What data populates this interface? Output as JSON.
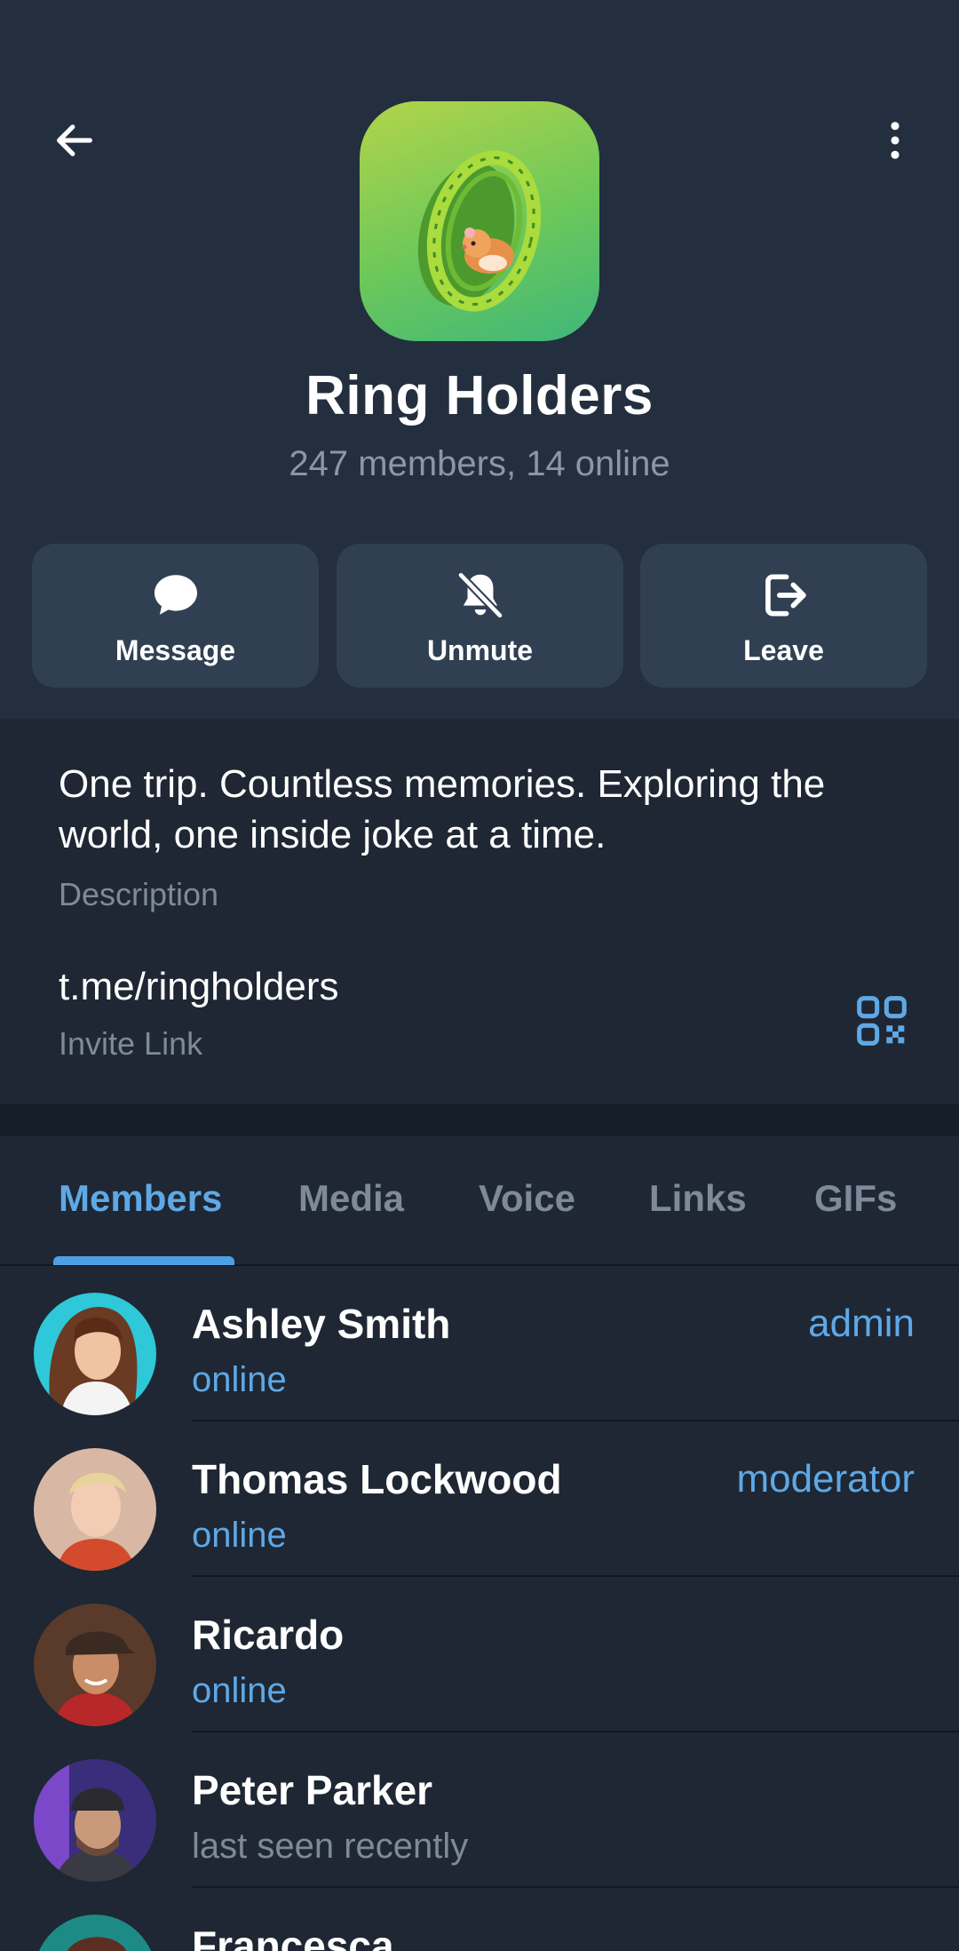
{
  "header": {
    "back_icon": "arrow-left-icon",
    "more_icon": "more-vertical-icon",
    "group_name": "Ring Holders",
    "group_sub": "247 members, 14 online"
  },
  "actions": [
    {
      "label": "Message",
      "icon": "message-icon"
    },
    {
      "label": "Unmute",
      "icon": "bell-off-icon"
    },
    {
      "label": "Leave",
      "icon": "logout-icon"
    }
  ],
  "info": {
    "description": "One trip. Countless memories. Exploring the world, one inside joke at a time.",
    "description_label": "Description",
    "invite_link": "t.me/ringholders",
    "invite_label": "Invite Link",
    "qr_icon": "qr-code-icon"
  },
  "tabs": [
    {
      "label": "Members",
      "active": true
    },
    {
      "label": "Media",
      "active": false
    },
    {
      "label": "Voice",
      "active": false
    },
    {
      "label": "Links",
      "active": false
    },
    {
      "label": "GIFs",
      "active": false
    }
  ],
  "members": [
    {
      "name": "Ashley Smith",
      "status": "online",
      "role": "admin"
    },
    {
      "name": "Thomas Lockwood",
      "status": "online",
      "role": "moderator"
    },
    {
      "name": "Ricardo",
      "status": "online",
      "role": ""
    },
    {
      "name": "Peter Parker",
      "status": "last seen recently",
      "role": ""
    },
    {
      "name": "Francesca",
      "status": "",
      "role": ""
    }
  ],
  "colors": {
    "accent": "#5fa8e6",
    "header_bg": "#232f3f",
    "body_bg": "#1e2733",
    "button_bg": "#313f52"
  }
}
